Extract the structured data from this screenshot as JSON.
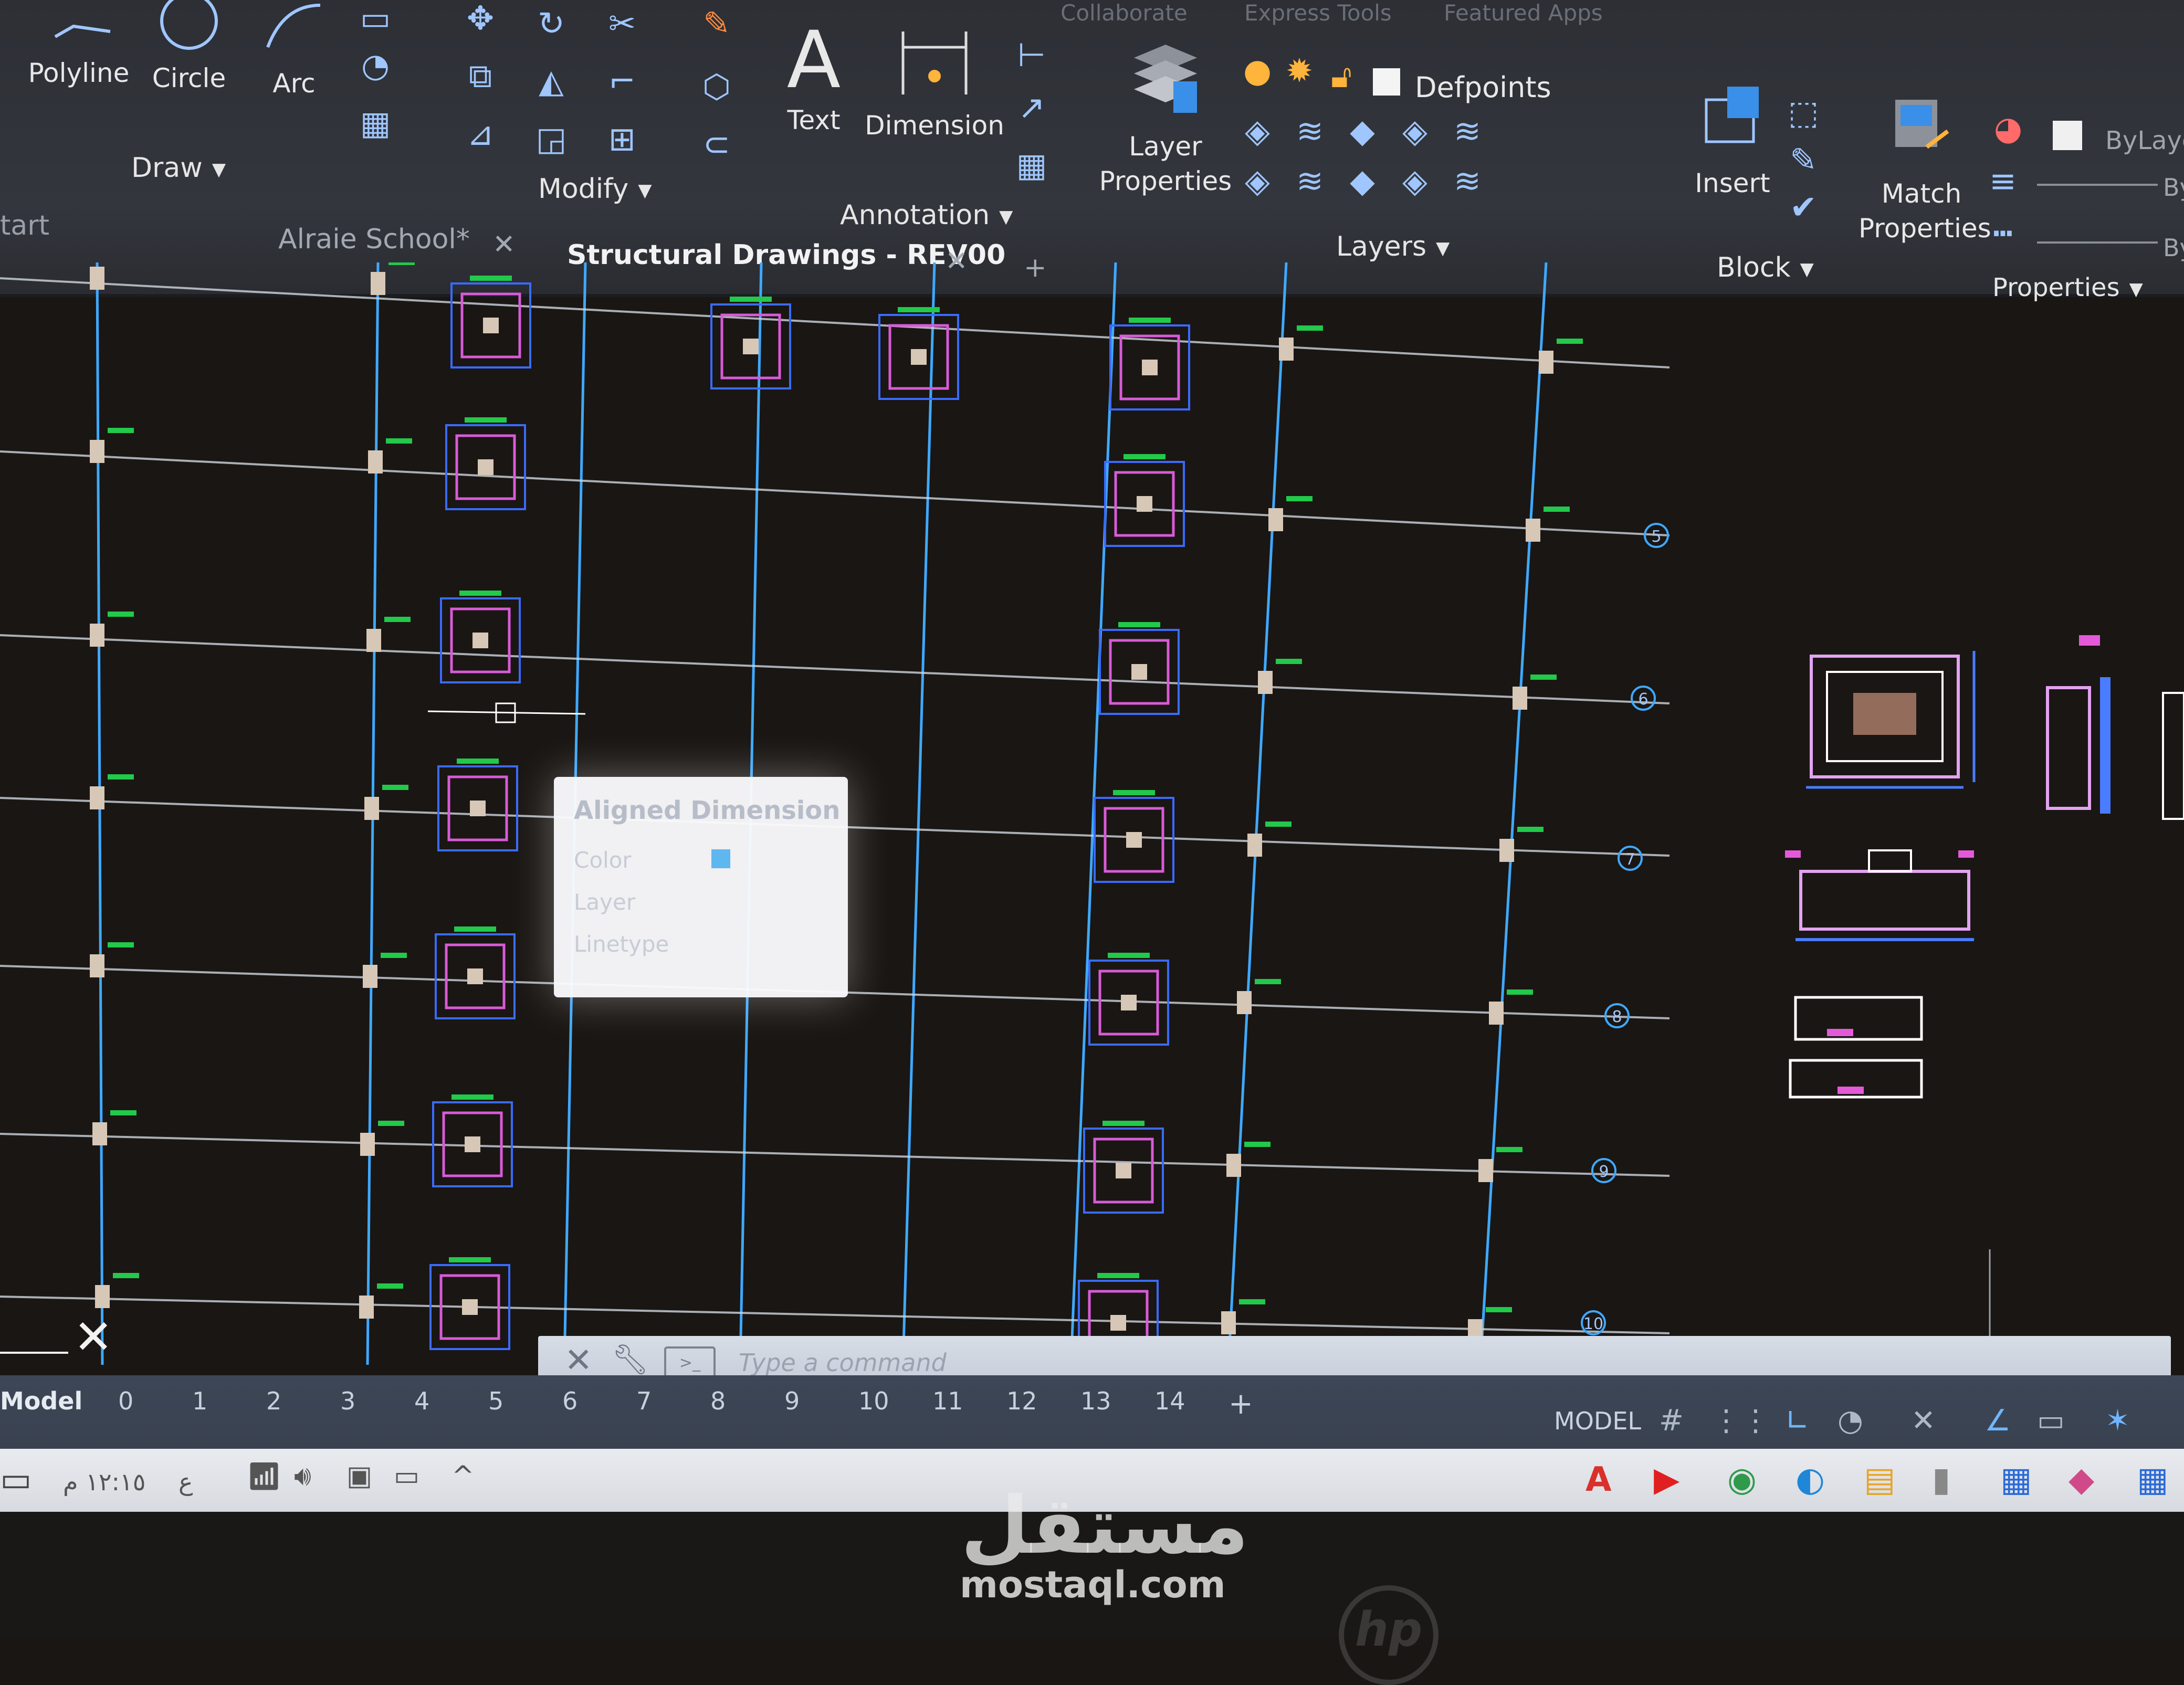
{
  "ribbon": {
    "top_menu": [
      "Collaborate",
      "Express Tools",
      "Featured Apps"
    ],
    "draw": {
      "polyline": "Polyline",
      "circle": "Circle",
      "arc": "Arc",
      "panel": "Draw"
    },
    "modify": {
      "panel": "Modify"
    },
    "annotation": {
      "text": "Text",
      "dimension": "Dimension",
      "panel": "Annotation"
    },
    "layers": {
      "layer_properties_1": "Layer",
      "layer_properties_2": "Properties",
      "current_layer": "Defpoints",
      "panel": "Layers"
    },
    "block": {
      "insert": "Insert",
      "panel": "Block"
    },
    "properties": {
      "match_1": "Match",
      "match_2": "Properties",
      "bylayer": "ByLayer",
      "by1": "By",
      "by2": "By",
      "panel": "Properties"
    }
  },
  "start_tab": "tart",
  "doc_tabs": [
    {
      "label": "Alraie School*",
      "active": false
    },
    {
      "label": "Structural Drawings - REV00",
      "active": true
    }
  ],
  "tooltip": {
    "title": "Aligned Dimension",
    "rows": [
      "Color",
      "Layer",
      "Linetype"
    ]
  },
  "grid_bubbles": [
    "5",
    "6",
    "7",
    "8",
    "9",
    "10"
  ],
  "command": {
    "placeholder": "Type a command"
  },
  "layouts": {
    "model": "Model",
    "tabs": [
      "0",
      "1",
      "2",
      "3",
      "4",
      "5",
      "6",
      "7",
      "8",
      "9",
      "10",
      "11",
      "12",
      "13",
      "14"
    ],
    "add": "+"
  },
  "status": {
    "mode": "MODEL"
  },
  "taskbar": {
    "clock": "١٢:١٥ م",
    "lang": "ع"
  },
  "watermark": {
    "arabic": "مستقل",
    "site": "mostaql.com"
  },
  "hardware": {
    "brand": "hp"
  },
  "colors": {
    "accent": "#3a8fe8",
    "grid": "#3fa9ff",
    "column_magenta": "#d85bd8",
    "green_tag": "#22c94a",
    "background": "#1a1613"
  }
}
